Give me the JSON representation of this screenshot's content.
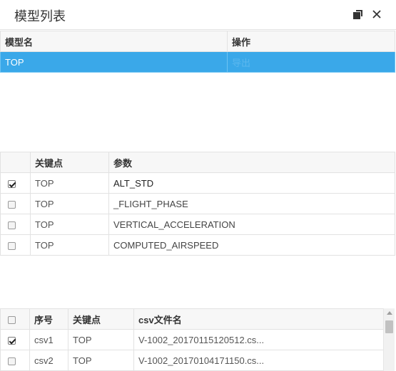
{
  "window": {
    "title": "模型列表",
    "restore_icon": "restore-window-icon",
    "close_icon": "close-icon"
  },
  "model_table": {
    "headers": [
      "模型名",
      "操作"
    ],
    "rows": [
      {
        "name": "TOP",
        "action": "导出",
        "selected": true
      }
    ]
  },
  "key_table": {
    "headers": [
      "",
      "关键点",
      "参数"
    ],
    "rows": [
      {
        "checked": true,
        "key": "TOP",
        "param": "ALT_STD"
      },
      {
        "checked": false,
        "key": "TOP",
        "param": "_FLIGHT_PHASE"
      },
      {
        "checked": false,
        "key": "TOP",
        "param": "VERTICAL_ACCELERATION"
      },
      {
        "checked": false,
        "key": "TOP",
        "param": "COMPUTED_AIRSPEED"
      }
    ]
  },
  "csv_table": {
    "headers": [
      "",
      "序号",
      "关键点",
      "csv文件名"
    ],
    "header_checked": false,
    "rows": [
      {
        "checked": true,
        "seq": "csv1",
        "key": "TOP",
        "file": "V-1002_20170115120512.cs..."
      },
      {
        "checked": false,
        "seq": "csv2",
        "key": "TOP",
        "file": "V-1002_20170104171150.cs..."
      }
    ]
  },
  "colors": {
    "selection": "#3aa8e9",
    "border": "#e2e2e2"
  }
}
